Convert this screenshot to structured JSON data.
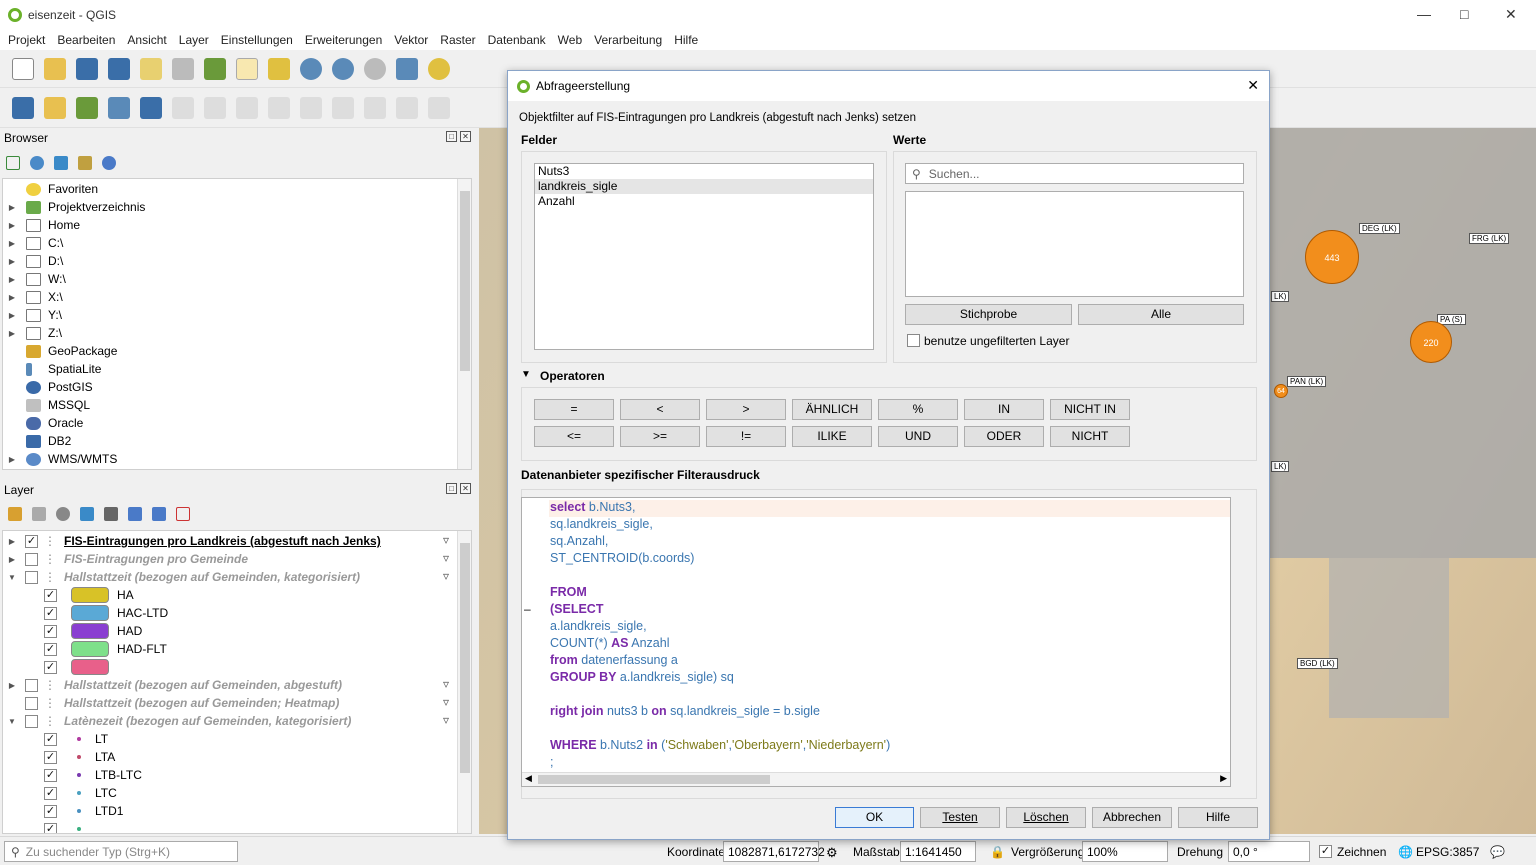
{
  "window": {
    "title": "eisenzeit - QGIS"
  },
  "menu": [
    "Projekt",
    "Bearbeiten",
    "Ansicht",
    "Layer",
    "Einstellungen",
    "Erweiterungen",
    "Vektor",
    "Raster",
    "Datenbank",
    "Web",
    "Verarbeitung",
    "Hilfe"
  ],
  "browser": {
    "title": "Browser",
    "items": [
      "Favoriten",
      "Projektverzeichnis",
      "Home",
      "C:\\",
      "D:\\",
      "W:\\",
      "X:\\",
      "Y:\\",
      "Z:\\",
      "GeoPackage",
      "SpatiaLite",
      "PostGIS",
      "MSSQL",
      "Oracle",
      "DB2",
      "WMS/WMTS"
    ]
  },
  "layers": {
    "title": "Layer",
    "items": [
      {
        "label": "FIS-Eintragungen pro Landkreis (abgestuft nach Jenks)"
      },
      {
        "label": "FIS-Eintragungen pro Gemeinde"
      },
      {
        "label": "Hallstattzeit (bezogen auf Gemeinden, kategorisiert)"
      },
      {
        "label": "HA",
        "color": "#d8c227"
      },
      {
        "label": "HAC-LTD",
        "color": "#5aa9d6"
      },
      {
        "label": "HAD",
        "color": "#8a3fd1"
      },
      {
        "label": "HAD-FLT",
        "color": "#7ee08a"
      },
      {
        "label": "",
        "color": "#e8608a"
      },
      {
        "label": "Hallstattzeit (bezogen auf Gemeinden, abgestuft)"
      },
      {
        "label": "Hallstattzeit (bezogen auf Gemeinden; Heatmap)"
      },
      {
        "label": "Latènezeit (bezogen auf Gemeinden, kategorisiert)"
      },
      {
        "label": "LT",
        "color": "#b03aa0"
      },
      {
        "label": "LTA",
        "color": "#c04a6a"
      },
      {
        "label": "LTB-LTC",
        "color": "#7a3ab0"
      },
      {
        "label": "LTC",
        "color": "#4aa0c0"
      },
      {
        "label": "LTD1",
        "color": "#4a90c0"
      },
      {
        "label": "",
        "color": "#3ab080"
      }
    ]
  },
  "map": {
    "labels": {
      "deg": "DEG (LK)",
      "frg": "FRG (LK)",
      "pa": "PA (S)",
      "pan": "PAN (LK)",
      "bgd": "BGD (LK)",
      "lk1": "LK)",
      "lk2": "LK)"
    },
    "bubbles": {
      "b1": "443",
      "b2": "220",
      "b3": "64"
    }
  },
  "status": {
    "search_placeholder": "Zu suchender Typ (Strg+K)",
    "coord_label": "Koordinate",
    "coord_value": "1082871,6172732",
    "scale_label": "Maßstab",
    "scale_value": "1:1641450",
    "magnifier_label": "Vergrößerung",
    "magnifier_value": "100%",
    "rotation_label": "Drehung",
    "rotation_value": "0,0 °",
    "render_label": "Zeichnen",
    "crs": "EPSG:3857"
  },
  "dialog": {
    "title": "Abfrageerstellung",
    "subtitle": "Objektfilter auf FIS-Eintragungen pro Landkreis (abgestuft nach Jenks) setzen",
    "fields_label": "Felder",
    "fields": [
      "Nuts3",
      "landkreis_sigle",
      "Anzahl"
    ],
    "values_label": "Werte",
    "search_placeholder": "Suchen...",
    "sample_button": "Stichprobe",
    "all_button": "Alle",
    "unfiltered_label": "benutze ungefilterten Layer",
    "operators_label": "Operatoren",
    "operators_row1": [
      "=",
      "<",
      ">",
      "ÄHNLICH",
      "%",
      "IN",
      "NICHT IN"
    ],
    "operators_row2": [
      "<=",
      ">=",
      "!=",
      "ILIKE",
      "UND",
      "ODER",
      "NICHT"
    ],
    "expr_label": "Datenanbieter spezifischer Filterausdruck",
    "sql": {
      "l1a": "select",
      "l1b": " b.Nuts3,",
      "l2": "sq.landkreis_sigle,",
      "l3": "sq.Anzahl,",
      "l4": "ST_CENTROID(b.coords)",
      "l6": "FROM",
      "l7": "(SELECT",
      "l8": "a.landkreis_sigle,",
      "l9a": "COUNT(*) ",
      "l9b": "AS",
      "l9c": " Anzahl",
      "l10a": "from",
      "l10b": " datenerfassung a",
      "l11a": "GROUP BY",
      "l11b": " a.landkreis_sigle) sq",
      "l13a": "right join",
      "l13b": " nuts3 b ",
      "l13c": "on",
      "l13d": " sq.landkreis_sigle = b.sigle",
      "l15a": "WHERE",
      "l15b": " b.Nuts2 ",
      "l15c": "in",
      "l15d": " (",
      "l15e": "'Schwaben'",
      "l15f": ",",
      "l15g": "'Oberbayern'",
      "l15h": ",",
      "l15i": "'Niederbayern'",
      "l15j": ")",
      "l16": ";"
    },
    "ok_button": "OK",
    "test_button": "Testen",
    "clear_button": "Löschen",
    "cancel_button": "Abbrechen",
    "help_button": "Hilfe"
  }
}
